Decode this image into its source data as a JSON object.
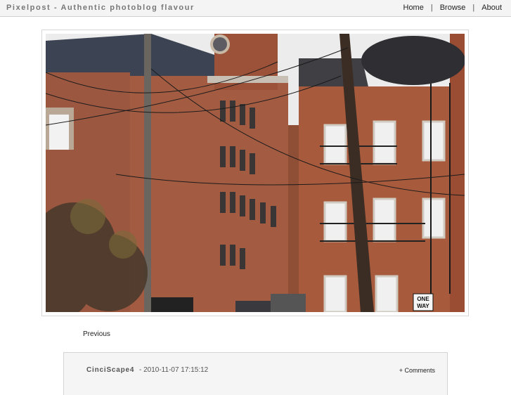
{
  "header": {
    "site_title": "Pixelpost - Authentic photoblog flavour",
    "nav": [
      {
        "label": "Home"
      },
      {
        "label": "Browse"
      },
      {
        "label": "About"
      }
    ],
    "separator": "|"
  },
  "photo": {
    "sign_line1": "ONE",
    "sign_line2": "WAY"
  },
  "navigation": {
    "previous_label": "Previous"
  },
  "info": {
    "title": "CinciScape4",
    "date": "- 2010-11-07 17:15:12",
    "comments_label": "+ Comments"
  },
  "colors": {
    "topbar_bg": "#f4f4f4",
    "brick": "#a65a3f",
    "sky": "#eeeeee"
  }
}
